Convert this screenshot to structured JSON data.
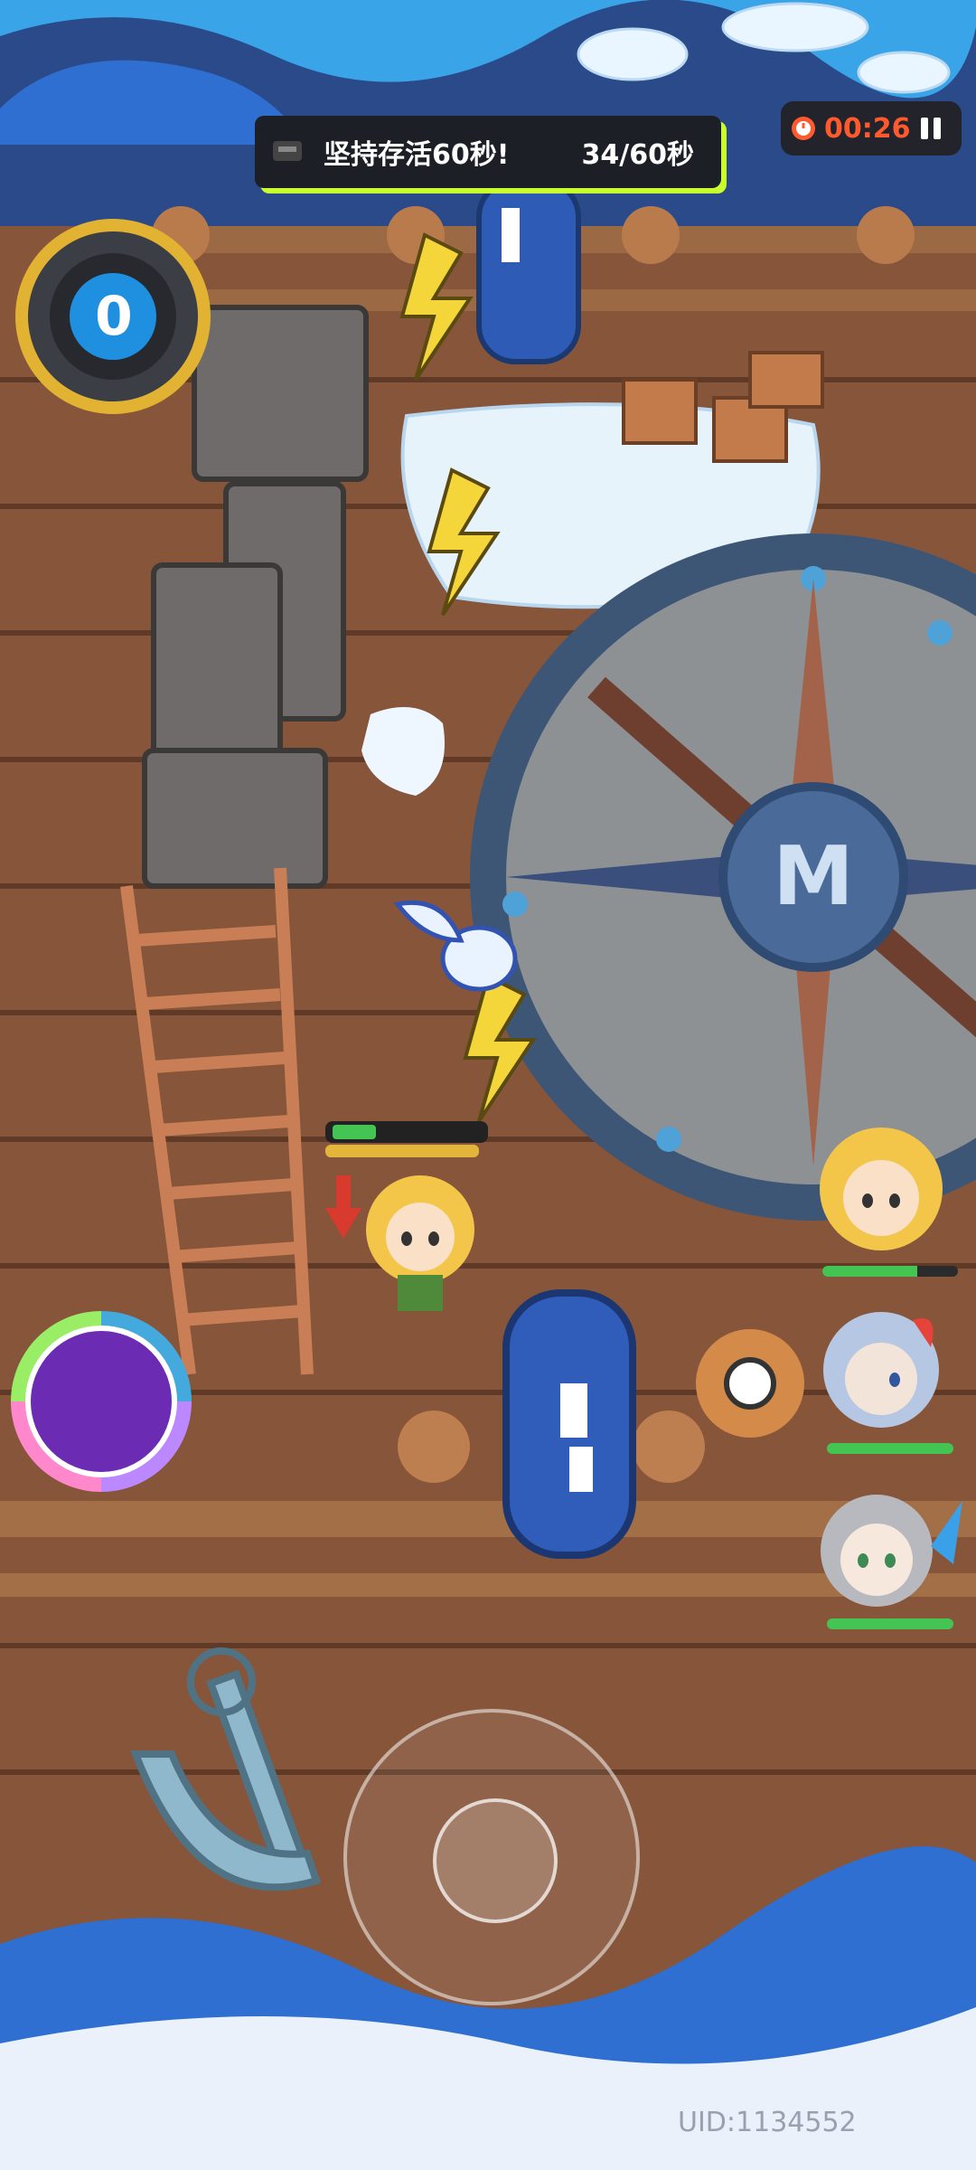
{
  "hud": {
    "objective_text": "坚持存活60秒!",
    "objective_progress": "34/60秒",
    "timer": "00:26",
    "combo_value": "0"
  },
  "party": [
    {
      "name": "blonde-hero",
      "hp": 0.7
    },
    {
      "name": "silver-hero",
      "hp": 1.0
    },
    {
      "name": "grey-hero",
      "hp": 1.0
    }
  ],
  "player": {
    "hp": 0.3,
    "energy": 1.0
  },
  "footer": {
    "uid": "UID:1134552"
  },
  "colors": {
    "accent_yellow": "#c9ff2c",
    "timer_red": "#ff5a2e",
    "hp_green": "#44c452"
  }
}
